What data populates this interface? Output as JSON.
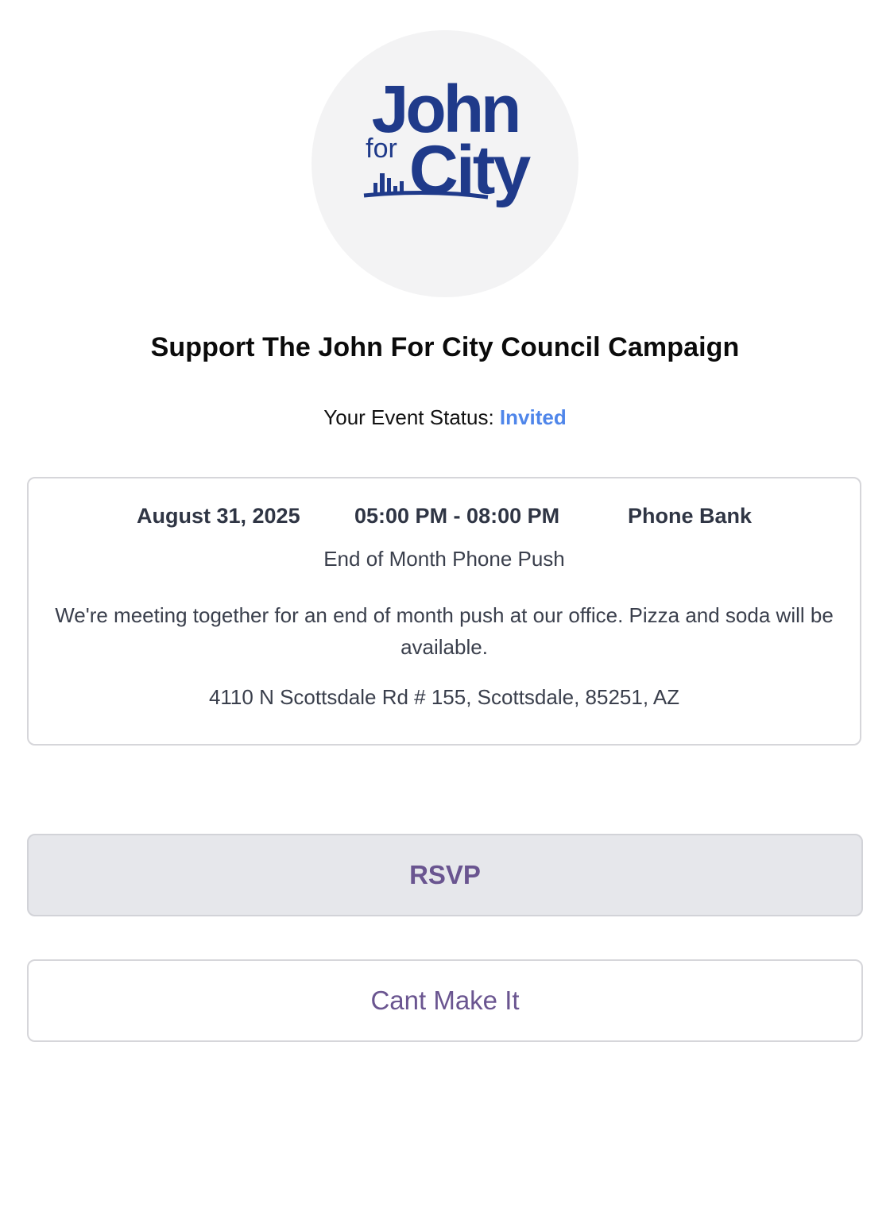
{
  "logo": {
    "line1": "John",
    "line2_small": "for",
    "line2_big": "City",
    "brand_color": "#1f3a8a",
    "icon": "city-skyline-icon"
  },
  "page_title": "Support The John For City Council Campaign",
  "status": {
    "label": "Your Event Status: ",
    "value": "Invited",
    "value_color": "#4f86ea"
  },
  "event": {
    "date": "August 31, 2025",
    "time": "05:00 PM - 08:00 PM",
    "type": "Phone Bank",
    "name": "End of Month Phone Push",
    "description": "We're meeting together for an end of month push at our office. Pizza and soda will be available.",
    "address": "4110 N Scottsdale Rd # 155, Scottsdale, 85251, AZ"
  },
  "buttons": {
    "rsvp_label": "RSVP",
    "cant_label": "Cant Make It",
    "accent_color": "#6a5590"
  }
}
